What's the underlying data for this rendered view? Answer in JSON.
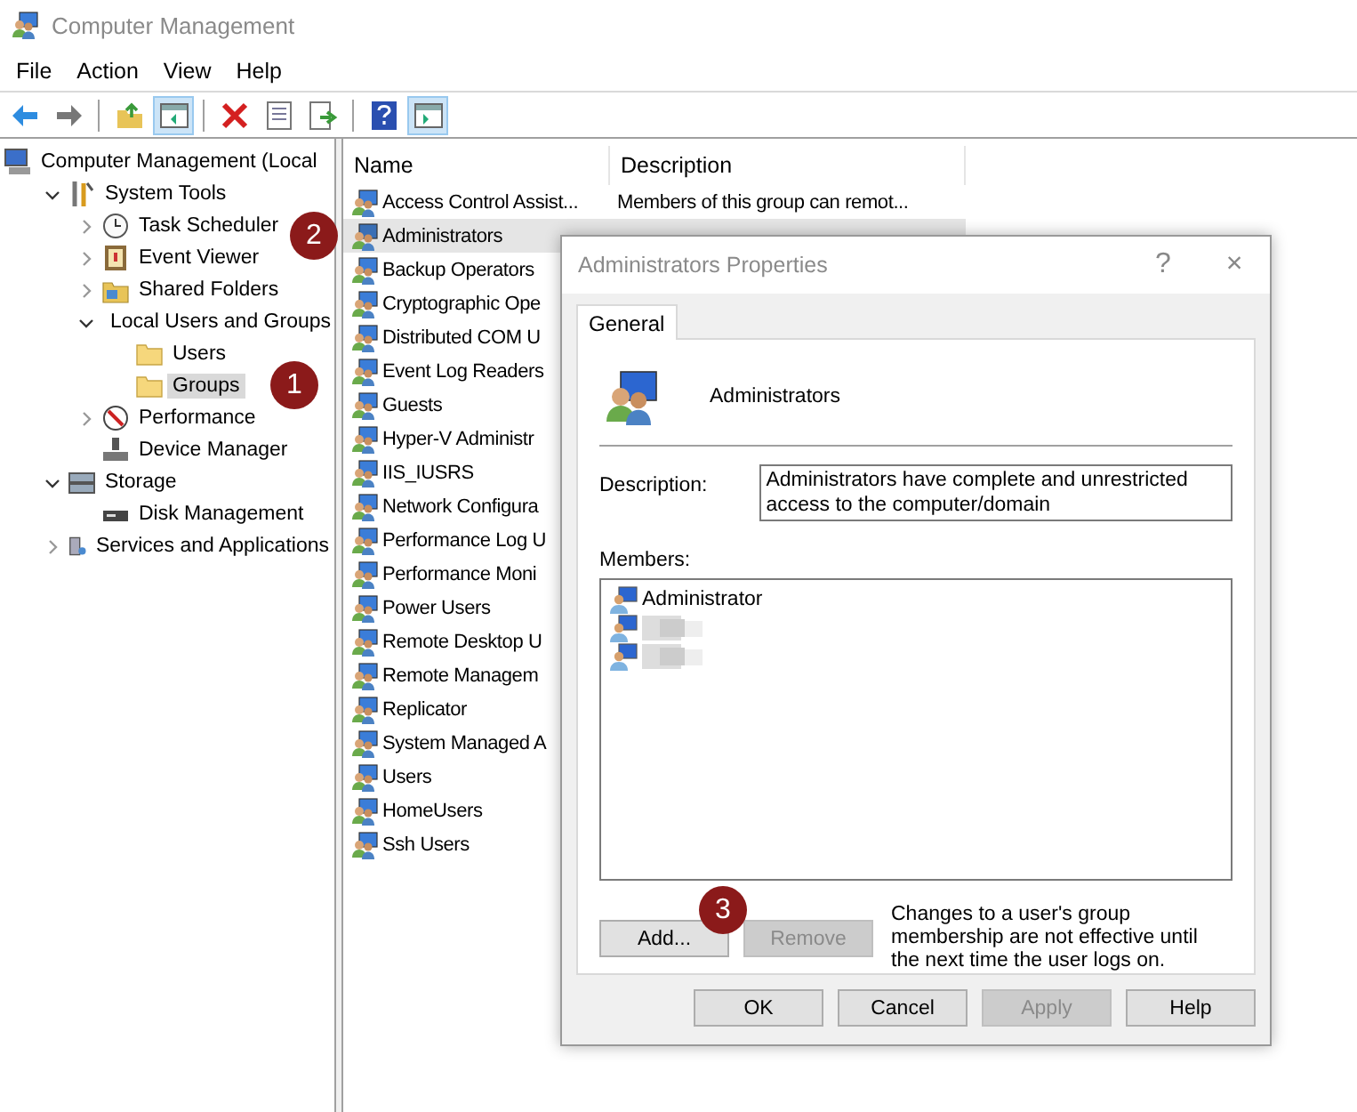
{
  "window": {
    "title": "Computer Management"
  },
  "menu": [
    "File",
    "Action",
    "View",
    "Help"
  ],
  "toolbar": [
    {
      "kind": "back",
      "pressed": false
    },
    {
      "kind": "forward",
      "pressed": false
    },
    {
      "kind": "sep"
    },
    {
      "kind": "up",
      "pressed": false
    },
    {
      "kind": "tree",
      "pressed": true
    },
    {
      "kind": "sep"
    },
    {
      "kind": "delete",
      "pressed": false
    },
    {
      "kind": "properties",
      "pressed": false
    },
    {
      "kind": "export",
      "pressed": false
    },
    {
      "kind": "sep"
    },
    {
      "kind": "help",
      "pressed": false
    },
    {
      "kind": "pane",
      "pressed": true
    }
  ],
  "tree": [
    {
      "label": "Computer Management (Local",
      "kind": "computer",
      "selected": false,
      "children": [
        {
          "label": "System Tools",
          "kind": "tools",
          "expanded": true,
          "selected": false,
          "children": [
            {
              "label": "Task Scheduler",
              "kind": "clock",
              "expanded": false,
              "selected": false
            },
            {
              "label": "Event Viewer",
              "kind": "viewer",
              "expanded": false,
              "selected": false
            },
            {
              "label": "Shared Folders",
              "kind": "share",
              "expanded": false,
              "selected": false
            },
            {
              "label": "Local Users and Groups",
              "kind": "users",
              "expanded": true,
              "selected": false,
              "children": [
                {
                  "label": "Users",
                  "kind": "folder",
                  "selected": false
                },
                {
                  "label": "Groups",
                  "kind": "folder",
                  "selected": true,
                  "badge": "1"
                }
              ]
            },
            {
              "label": "Performance",
              "kind": "perf",
              "expanded": false,
              "selected": false
            },
            {
              "label": "Device Manager",
              "kind": "device",
              "selected": false
            }
          ]
        },
        {
          "label": "Storage",
          "kind": "storage",
          "expanded": true,
          "selected": false,
          "children": [
            {
              "label": "Disk Management",
              "kind": "disk",
              "selected": false
            }
          ]
        },
        {
          "label": "Services and Applications",
          "kind": "services",
          "expanded": false,
          "selected": false
        }
      ]
    }
  ],
  "table": {
    "columns": [
      "Name",
      "Description"
    ],
    "rows": [
      {
        "name": "Access Control Assist...",
        "description": "Members of this group can remot...",
        "selected": false
      },
      {
        "name": "Administrators",
        "selected": true,
        "badge": "2"
      },
      {
        "name": "Backup Operators",
        "selected": false
      },
      {
        "name": "Cryptographic Ope",
        "selected": false
      },
      {
        "name": "Distributed COM U",
        "selected": false
      },
      {
        "name": "Event Log Readers",
        "selected": false
      },
      {
        "name": "Guests",
        "selected": false
      },
      {
        "name": "Hyper-V Administr",
        "selected": false
      },
      {
        "name": "IIS_IUSRS",
        "selected": false
      },
      {
        "name": "Network Configura",
        "selected": false
      },
      {
        "name": "Performance Log U",
        "selected": false
      },
      {
        "name": "Performance Moni",
        "selected": false
      },
      {
        "name": "Power Users",
        "selected": false
      },
      {
        "name": "Remote Desktop U",
        "selected": false
      },
      {
        "name": "Remote Managem",
        "selected": false
      },
      {
        "name": "Replicator",
        "selected": false
      },
      {
        "name": "System Managed A",
        "selected": false
      },
      {
        "name": "Users",
        "selected": false
      },
      {
        "name": "HomeUsers",
        "selected": false
      },
      {
        "name": "Ssh Users",
        "selected": false
      }
    ]
  },
  "dialog": {
    "title": "Administrators Properties",
    "help": "?",
    "close": "×",
    "tabs": [
      {
        "label": "General",
        "selected": true
      }
    ],
    "group_name": "Administrators",
    "description_label": "Description:",
    "description": "Administrators have complete and unrestricted access to the computer/domain",
    "members_label": "Members:",
    "members": [
      {
        "kind": "user",
        "name": "Administrator"
      },
      {
        "kind": "redacted"
      },
      {
        "kind": "redacted"
      }
    ],
    "add": {
      "label": "Add...",
      "disabled": false,
      "badge": "3"
    },
    "remove": {
      "label": "Remove",
      "disabled": true
    },
    "note": "Changes to a user's group membership are not effective until the next time the user logs on.",
    "buttons": [
      {
        "label": "OK",
        "disabled": false
      },
      {
        "label": "Cancel",
        "disabled": false
      },
      {
        "label": "Apply",
        "disabled": true
      },
      {
        "label": "Help",
        "disabled": false
      }
    ]
  }
}
